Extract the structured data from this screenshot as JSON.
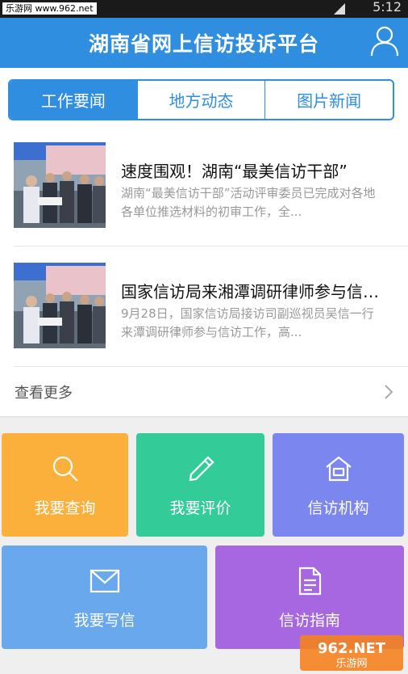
{
  "status_bar": {
    "watermark": "乐游网 www.962.net",
    "time": "5:12"
  },
  "header": {
    "title": "湖南省网上信访投诉平台",
    "user_icon": "user-icon"
  },
  "tabs": [
    {
      "label": "工作要闻",
      "active": true
    },
    {
      "label": "地方动态",
      "active": false
    },
    {
      "label": "图片新闻",
      "active": false
    }
  ],
  "news": [
    {
      "headline": "速度围观！湖南“最美信访干部”",
      "summary": "湖南“最美信访干部”活动评审委员已完成对各地各单位推选材料的初审工作，全..."
    },
    {
      "headline": "国家信访局来湘潭调研律师参与信访工作",
      "summary": "9月28日，国家信访局接访司副巡视员吴信一行来潭调研律师参与信访工作，高..."
    }
  ],
  "more": {
    "label": "查看更多"
  },
  "tiles": [
    {
      "label": "我要查询",
      "icon": "search-icon",
      "color": "#fbb03b"
    },
    {
      "label": "我要评价",
      "icon": "pen-icon",
      "color": "#33cc99"
    },
    {
      "label": "信访机构",
      "icon": "home-icon",
      "color": "#7b86ee"
    },
    {
      "label": "我要写信",
      "icon": "mail-icon",
      "color": "#6aa8ee"
    },
    {
      "label": "信访指南",
      "icon": "document-icon",
      "color": "#a667e0"
    }
  ],
  "watermark": {
    "text_top": "962.NET",
    "text_bottom": "乐游网"
  }
}
